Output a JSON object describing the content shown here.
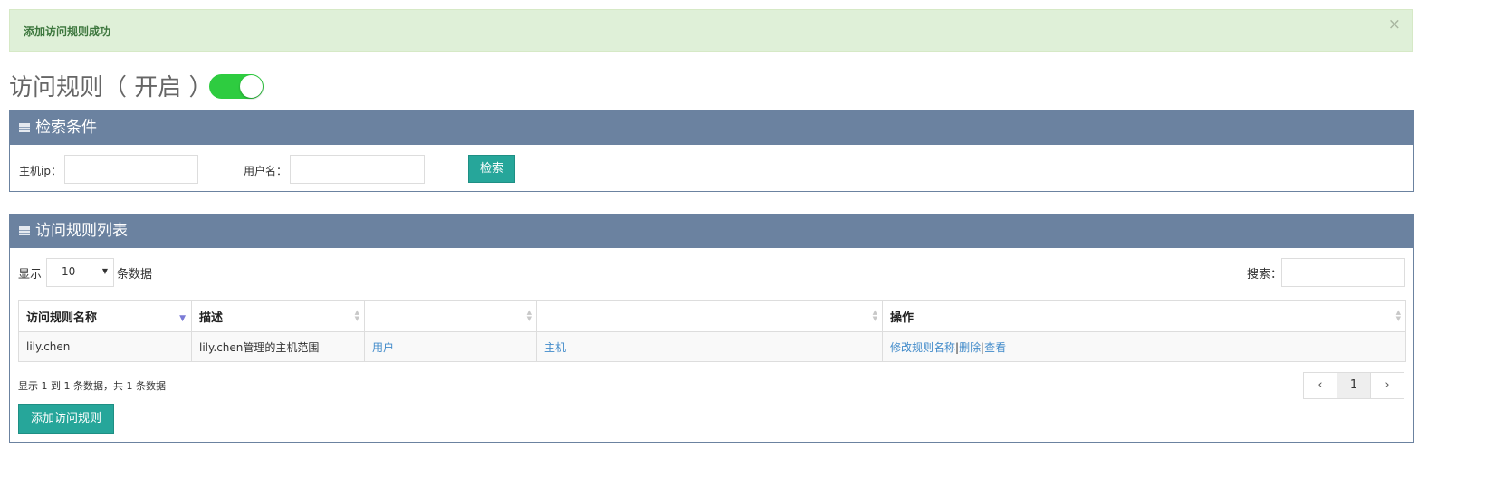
{
  "alert": {
    "message": "添加访问规则成功",
    "close": "×"
  },
  "title": {
    "text": "访问规则（ 开启 ）",
    "toggle_on": true
  },
  "search_panel": {
    "heading": "检索条件",
    "host_ip_label": "主机ip：",
    "host_ip_value": "",
    "username_label": "用户名：",
    "username_value": "",
    "search_button": "检索"
  },
  "list_panel": {
    "heading": "访问规则列表",
    "show_label": "显示",
    "page_size": "10",
    "entries_label": "条数据",
    "filter_label": "搜索：",
    "filter_value": "",
    "columns": [
      "访问规则名称",
      "描述",
      "",
      "",
      "操作"
    ],
    "rows": [
      {
        "name": "lily.chen",
        "description": "lily.chen管理的主机范围",
        "users_link": "用户",
        "hosts_link": "主机",
        "actions": [
          "修改规则名称",
          "删除",
          "查看"
        ]
      }
    ],
    "info": {
      "prefix": "显示",
      "start": "1",
      "to": "到",
      "end": "1",
      "mid": "条数据，共",
      "total": "1",
      "suffix": "条数据"
    },
    "pagination": {
      "prev": "‹",
      "current": "1",
      "next": "›"
    },
    "add_button": "添加访问规则"
  },
  "colors": {
    "header": "#6b82a0",
    "teal": "#26a69a",
    "alert_bg": "#dff0d8",
    "toggle": "#2ecc40",
    "link": "#428bca"
  }
}
